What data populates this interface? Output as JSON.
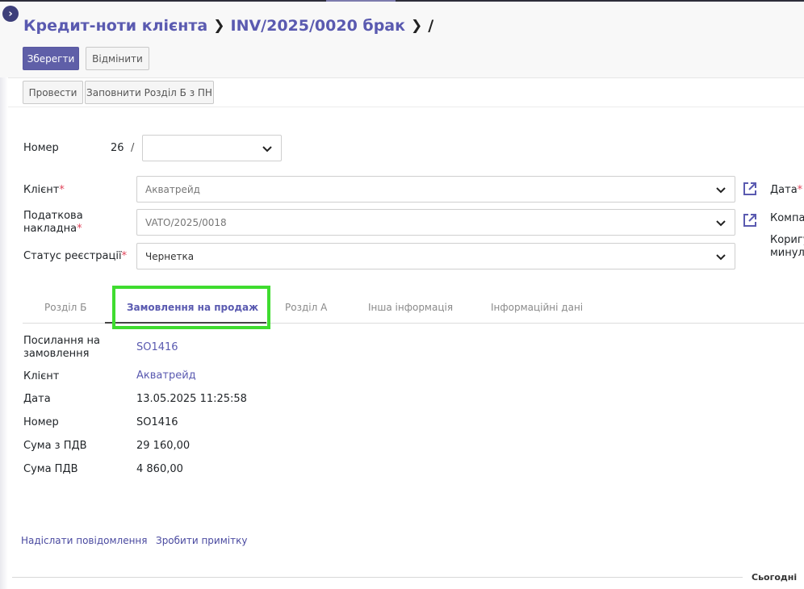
{
  "breadcrumb": {
    "root": "Кредит-ноти клієнта",
    "record": "INV/2025/0020 брак",
    "current": "/"
  },
  "toolbar": {
    "save_label": "Зберегти",
    "discard_label": "Відмінити",
    "post_label": "Провести",
    "fill_label": "Заповнити Розділ Б з ПН"
  },
  "form": {
    "number_label": "Номер",
    "number_value": "26",
    "number_slash": "/",
    "number_select": "",
    "client_label": "Клієнт",
    "client_value": "Акватрейд",
    "tax_invoice_label_1": "Податкова",
    "tax_invoice_label_2": "накладна",
    "tax_invoice_value": "VATO/2025/0018",
    "status_label": "Статус реєстрації",
    "status_value": "Чернетка",
    "required_mark": "*",
    "date_label": "Дата",
    "company_label": "Компа",
    "correction_label_1": "Коригу",
    "correction_label_2": "минул"
  },
  "tabs": [
    {
      "label": "Розділ Б"
    },
    {
      "label": "Замовлення на продаж"
    },
    {
      "label": "Розділ А"
    },
    {
      "label": "Інша інформація"
    },
    {
      "label": "Інформаційні дані"
    }
  ],
  "sale_order": {
    "ref_label_1": "Посилання на",
    "ref_label_2": "замовлення",
    "ref_value": "SO1416",
    "client_label": "Клієнт",
    "client_value": "Акватрейд",
    "date_label": "Дата",
    "date_value": "13.05.2025 11:25:58",
    "number_label": "Номер",
    "number_value": "SO1416",
    "total_label": "Сума з ПДВ",
    "total_value": "29 160,00",
    "vat_label": "Сума ПДВ",
    "vat_value": "4 860,00"
  },
  "chatter": {
    "send_message": "Надіслати повідомлення",
    "log_note": "Зробити примітку",
    "today": "Сьогодні"
  },
  "colors": {
    "primary": "#5f5fa8",
    "link": "#5a5ab0",
    "highlight": "#3fdc2f",
    "required": "#e0445a"
  }
}
